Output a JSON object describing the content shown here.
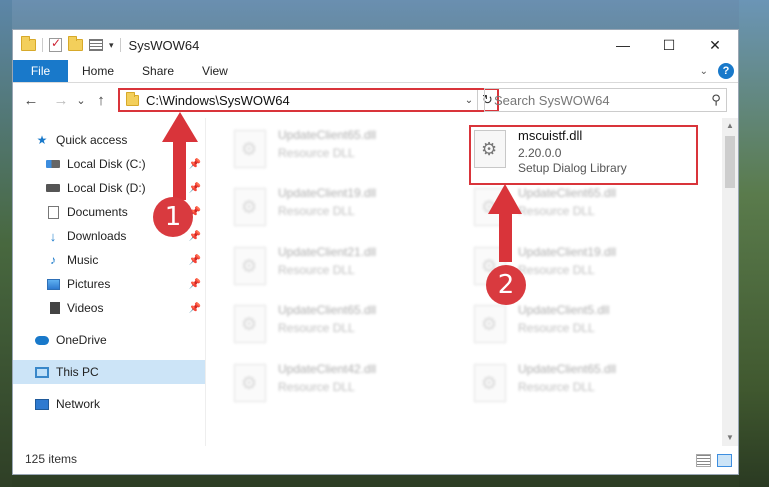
{
  "window": {
    "title": "SysWOW64",
    "controls": {
      "minimize": "—",
      "maximize": "☐",
      "close": "✕"
    }
  },
  "ribbon": {
    "tabs": [
      "File",
      "Home",
      "Share",
      "View"
    ],
    "help": "?"
  },
  "nav": {
    "back": "←",
    "forward": "→",
    "recent": "⌄",
    "up": "↑",
    "address": "C:\\Windows\\SysWOW64",
    "search_placeholder": "Search SysWOW64"
  },
  "sidebar": {
    "quick_access": "Quick access",
    "items": [
      {
        "label": "Local Disk (C:)",
        "icon": "drive-c-icon",
        "pinned": true
      },
      {
        "label": "Local Disk (D:)",
        "icon": "drive-icon",
        "pinned": true
      },
      {
        "label": "Documents",
        "icon": "documents-icon",
        "pinned": true
      },
      {
        "label": "Downloads",
        "icon": "downloads-icon",
        "pinned": true
      },
      {
        "label": "Music",
        "icon": "music-icon",
        "pinned": true
      },
      {
        "label": "Pictures",
        "icon": "pictures-icon",
        "pinned": true
      },
      {
        "label": "Videos",
        "icon": "videos-icon",
        "pinned": true
      }
    ],
    "onedrive": "OneDrive",
    "this_pc": "This PC",
    "network": "Network"
  },
  "files": {
    "highlighted": {
      "name": "mscuistf.dll",
      "version": "2.20.0.0",
      "description": "Setup Dialog Library"
    },
    "left_column": [
      {
        "name": "UpdateClient65.dll",
        "description": "Resource DLL"
      },
      {
        "name": "UpdateClient19.dll",
        "description": "Resource DLL"
      },
      {
        "name": "UpdateClient21.dll",
        "description": "Resource DLL"
      },
      {
        "name": "UpdateClient65.dll",
        "description": "Resource DLL"
      },
      {
        "name": "UpdateClient42.dll",
        "description": "Resource DLL"
      }
    ],
    "right_column": [
      {
        "name": "UpdateClient65.dll",
        "description": "Resource DLL"
      },
      {
        "name": "UpdateClient19.dll",
        "description": "Resource DLL"
      },
      {
        "name": "UpdateClient5.dll",
        "description": "Resource DLL"
      },
      {
        "name": "UpdateClient65.dll",
        "description": "Resource DLL"
      }
    ]
  },
  "status": {
    "item_count": "125 items"
  },
  "annotations": {
    "step1": "1",
    "step2": "2",
    "color": "#d9343a"
  }
}
